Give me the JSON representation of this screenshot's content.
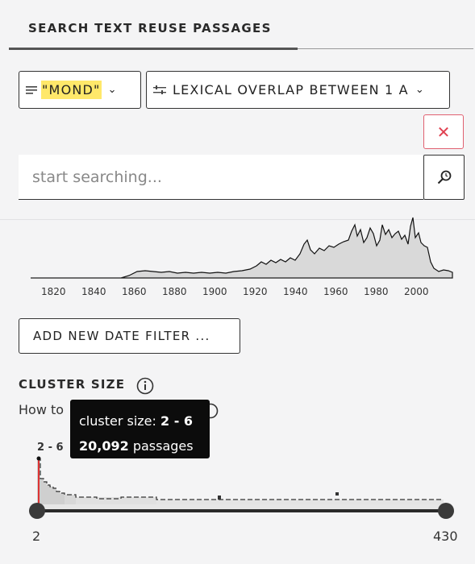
{
  "tab": {
    "title": "SEARCH TEXT REUSE PASSAGES"
  },
  "query": {
    "label": "\"MOND\""
  },
  "mode": {
    "label": "LEXICAL OVERLAP BETWEEN 1 A"
  },
  "search": {
    "placeholder": "start searching..."
  },
  "timeline": {
    "x_labels": [
      "1820",
      "1840",
      "1860",
      "1880",
      "1900",
      "1920",
      "1940",
      "1960",
      "1980",
      "2000"
    ]
  },
  "date_filter": {
    "label": "ADD NEW DATE FILTER ..."
  },
  "cluster": {
    "title": "CLUSTER SIZE",
    "howto": "How to",
    "bar_label": "2 - 6",
    "range_min": "2",
    "range_max": "430"
  },
  "tooltip": {
    "size_prefix": "cluster size: ",
    "size_value": "2 - 6",
    "count": "20,092",
    "count_suffix": " passages"
  }
}
